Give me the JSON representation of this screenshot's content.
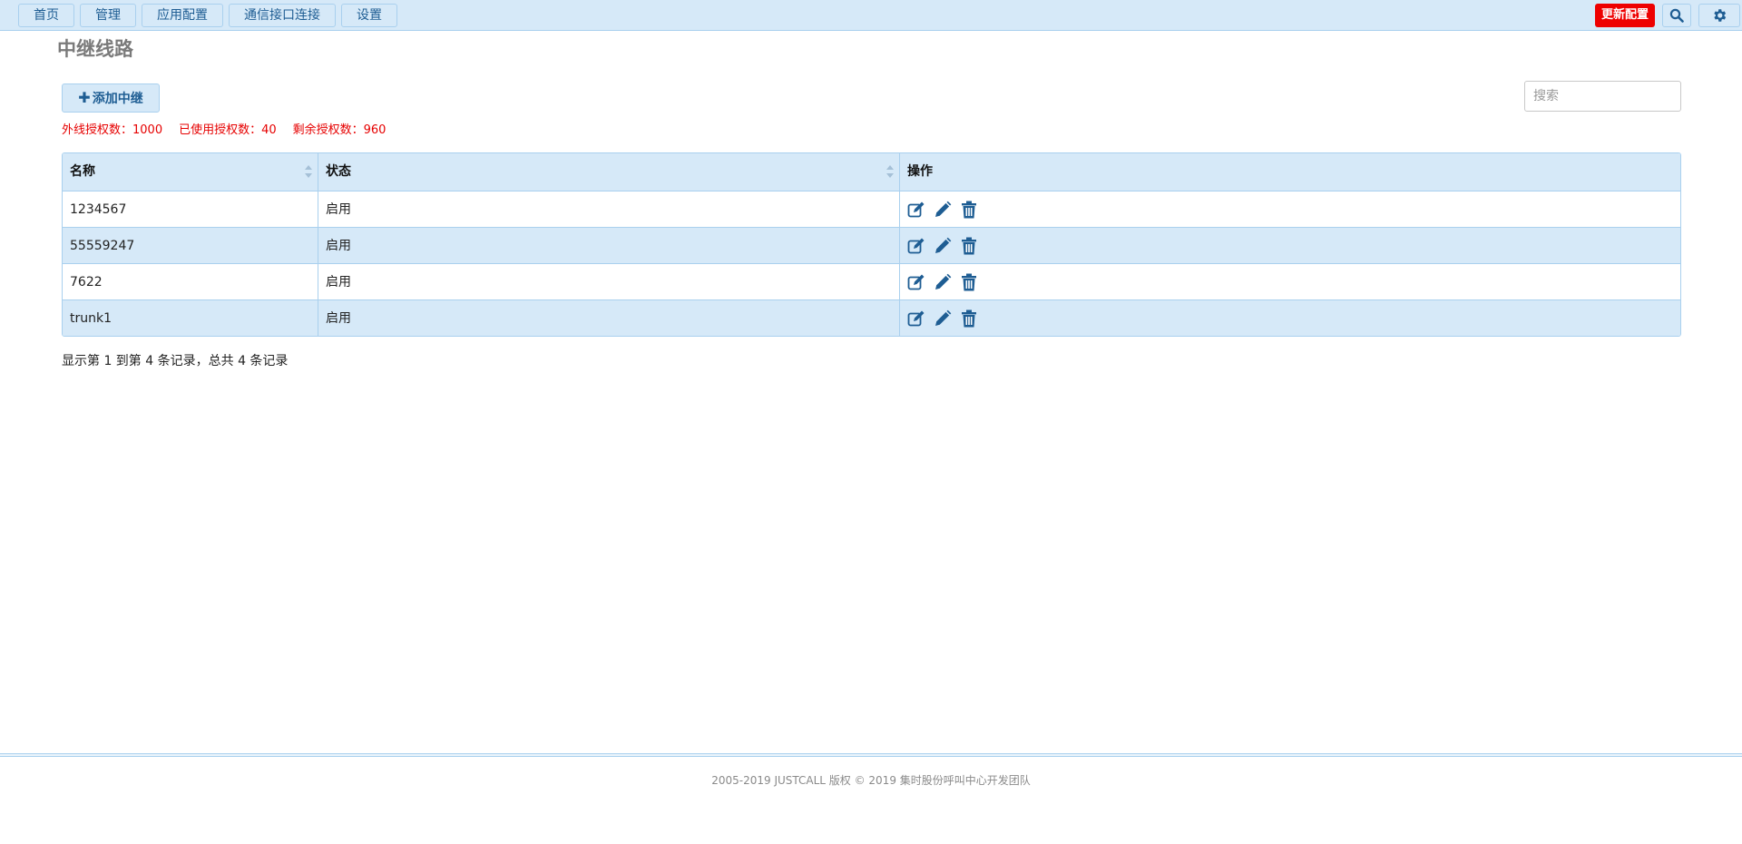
{
  "nav": {
    "tabs": [
      "首页",
      "管理",
      "应用配置",
      "通信接口连接",
      "设置"
    ],
    "update_label": "更新配置",
    "search_icon": "search-icon",
    "settings_icon": "gear-icon"
  },
  "page": {
    "title": "中继线路",
    "add_label": "添加中继",
    "search_placeholder": "搜索"
  },
  "license": {
    "total": "外线授权数：1000",
    "used": "已使用授权数：40",
    "remaining": "剩余授权数：960"
  },
  "table": {
    "columns": [
      "名称",
      "状态",
      "操作"
    ],
    "rows": [
      {
        "name": "1234567",
        "status": "启用"
      },
      {
        "name": "55559247",
        "status": "启用"
      },
      {
        "name": "7622",
        "status": "启用"
      },
      {
        "name": "trunk1",
        "status": "启用"
      }
    ],
    "action_icons": [
      "edit-icon",
      "pencil-icon",
      "trash-icon"
    ]
  },
  "summary": "显示第 1 到第 4 条记录，总共 4 条记录",
  "footer": "2005-2019 JUSTCALL 版权 © 2019 集时股份呼叫中心开发团队",
  "colors": {
    "accent": "#1e5d93",
    "bar": "#d6e9f8",
    "border": "#a9d0ee",
    "alert": "#e60000"
  }
}
